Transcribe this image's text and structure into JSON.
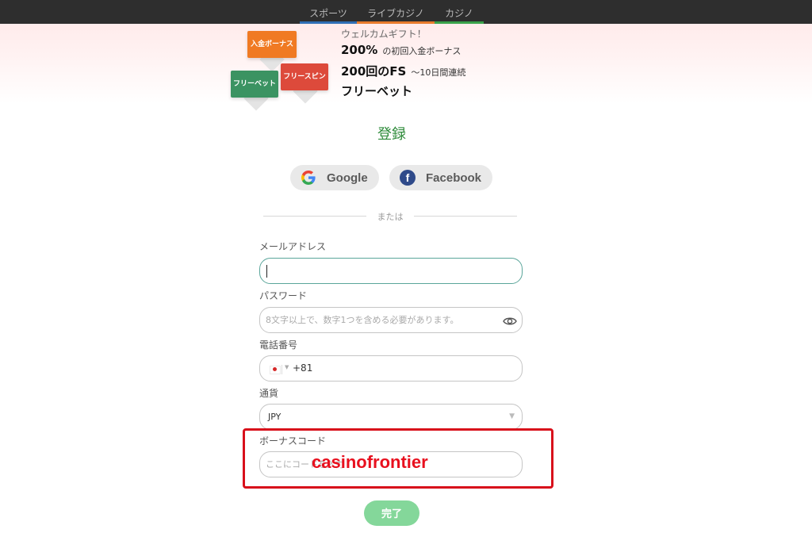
{
  "nav": {
    "tabs": [
      {
        "label": "スポーツ"
      },
      {
        "label": "ライブカジノ"
      },
      {
        "label": "カジノ"
      }
    ]
  },
  "badges": {
    "deposit": "入金ボーナス",
    "freespin": "フリースピン",
    "freebet": "フリーベット"
  },
  "promo": {
    "welcome": "ウェルカムギフト！",
    "line1_big": "200%",
    "line1_small": "の初回入金ボーナス",
    "line2_big": "200回のFS",
    "line2_small": "～10日間連続",
    "line3_big": "フリーベット"
  },
  "register": {
    "title": "登録",
    "google_label": "Google",
    "facebook_label": "Facebook",
    "or_text": "または",
    "email": {
      "label": "メールアドレス",
      "value": ""
    },
    "password": {
      "label": "パスワード",
      "placeholder": "8文字以上で、数字1つを含める必要があります。"
    },
    "phone": {
      "label": "電話番号",
      "dial_code": "+81"
    },
    "currency": {
      "label": "通貨",
      "value": "JPY"
    },
    "bonus": {
      "label": "ボーナスコード",
      "placeholder": "ここにコードを入力"
    },
    "submit_label": "完了"
  },
  "overlay": {
    "code": "casinofrontier"
  },
  "colors": {
    "accent_green": "#2e8b3a",
    "submit_green": "#84d79a",
    "highlight_red": "#d8101b"
  }
}
